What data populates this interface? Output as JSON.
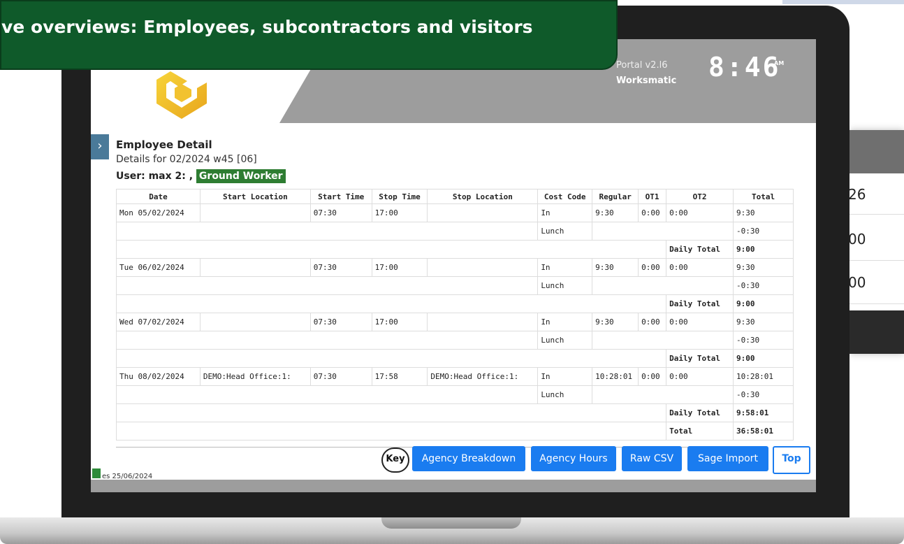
{
  "banner": {
    "text": "ve overviews: Employees, subcontractors and visitors"
  },
  "header": {
    "portal_version": "Portal v2.l6",
    "portal_name": "Worksmatic",
    "clock": "8:46",
    "ampm": "AM"
  },
  "page": {
    "title": "Employee Detail",
    "subtitle": "Details for 02/2024 w45 [06]",
    "user_label": "User: max 2: ,",
    "role": "Ground Worker"
  },
  "table": {
    "columns": [
      "Date",
      "Start Location",
      "Start Time",
      "Stop Time",
      "Stop Location",
      "Cost Code",
      "Regular",
      "OT1",
      "OT2",
      "Total"
    ],
    "rows": [
      {
        "date": "Mon 05/02/2024",
        "start_location": "",
        "start_time": "07:30",
        "stop_time": "17:00",
        "stop_location": "",
        "cost_code": "In",
        "regular": "9:30",
        "ot1": "0:00",
        "ot2": "0:00",
        "total": "9:30"
      },
      {
        "cost_code": "Lunch",
        "total": "-0:30"
      },
      {
        "daily_label": "Daily Total",
        "daily_total": "9:00"
      },
      {
        "date": "Tue 06/02/2024",
        "start_location": "",
        "start_time": "07:30",
        "stop_time": "17:00",
        "stop_location": "",
        "cost_code": "In",
        "regular": "9:30",
        "ot1": "0:00",
        "ot2": "0:00",
        "total": "9:30"
      },
      {
        "cost_code": "Lunch",
        "total": "-0:30"
      },
      {
        "daily_label": "Daily Total",
        "daily_total": "9:00"
      },
      {
        "date": "Wed 07/02/2024",
        "start_location": "",
        "start_time": "07:30",
        "stop_time": "17:00",
        "stop_location": "",
        "cost_code": "In",
        "regular": "9:30",
        "ot1": "0:00",
        "ot2": "0:00",
        "total": "9:30"
      },
      {
        "cost_code": "Lunch",
        "total": "-0:30"
      },
      {
        "daily_label": "Daily Total",
        "daily_total": "9:00"
      },
      {
        "date": "Thu 08/02/2024",
        "start_location": "DEMO:Head Office:1:",
        "start_time": "07:30",
        "stop_time": "17:58",
        "stop_location": "DEMO:Head Office:1:",
        "cost_code": "In",
        "regular": "10:28:01",
        "ot1": "0:00",
        "ot2": "0:00",
        "total": "10:28:01"
      },
      {
        "cost_code": "Lunch",
        "total": "-0:30"
      },
      {
        "daily_label": "Daily Total",
        "daily_total": "9:58:01"
      },
      {
        "grand_label": "Total",
        "grand_total": "36:58:01"
      }
    ]
  },
  "buttons": {
    "key": "Key",
    "agency_breakdown": "Agency Breakdown",
    "agency_hours": "Agency Hours",
    "raw_csv": "Raw CSV",
    "sage_import": "Sage Import",
    "top": "Top"
  },
  "footer": {
    "text": "es 25/06/2024"
  },
  "background_panel": {
    "values": [
      "26",
      "00",
      "00"
    ]
  },
  "colors": {
    "banner_bg": "#0f5a2a",
    "header_grey": "#9d9d9d",
    "button_blue": "#1a7cf0",
    "role_badge": "#2e7d32",
    "side_toggle": "#4a7a99"
  }
}
